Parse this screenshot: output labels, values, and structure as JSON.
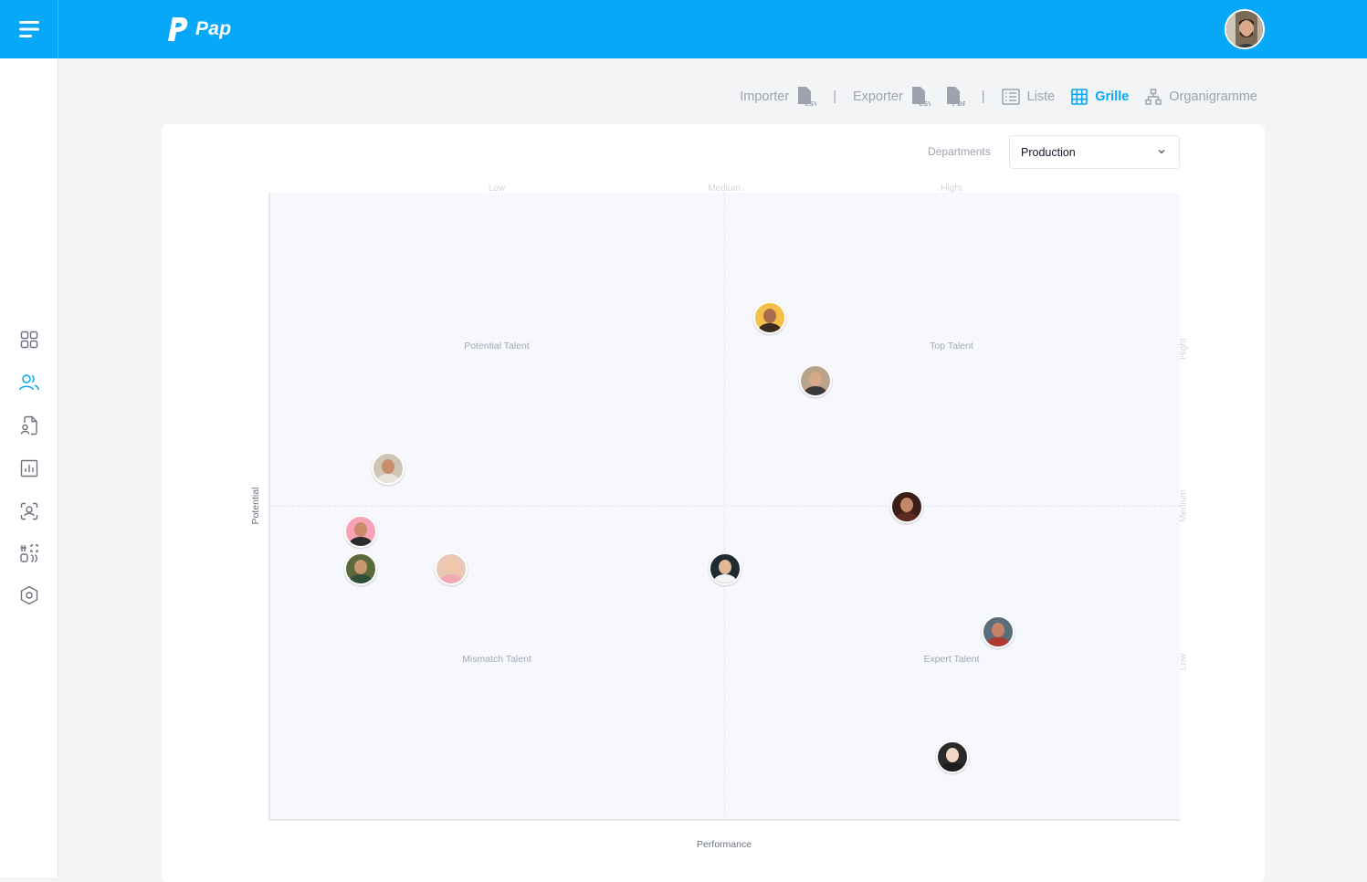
{
  "app": {
    "name": "Pap"
  },
  "toolbar": {
    "import_label": "Importer",
    "export_label": "Exporter",
    "sep": "|",
    "list_label": "Liste",
    "grid_label": "Grille",
    "orgchart_label": "Organigramme",
    "csv_badge": "CSV",
    "pdf_badge": "PDF"
  },
  "filter": {
    "label": "Departments",
    "selected": "Production"
  },
  "grid": {
    "x_axis_label": "Performance",
    "y_axis_label": "Potential",
    "col_labels": [
      "Low",
      "Medium",
      "Hight"
    ],
    "row_labels": [
      "Hight",
      "Medium",
      "Low"
    ],
    "quadrants": {
      "top_left": "Potential Talent",
      "top_right": "Top Talent",
      "bottom_left": "Mismatch Talent",
      "bottom_right": "Expert Talent"
    }
  },
  "colors": {
    "primary": "#08a8f8",
    "plot_bg": "#f7f7fe"
  },
  "chart_data": {
    "type": "scatter",
    "xlabel": "Performance",
    "ylabel": "Potential",
    "xlim": [
      0,
      1
    ],
    "ylim": [
      0,
      1
    ],
    "points": [
      {
        "x": 0.55,
        "y": 0.8,
        "bg": "#f5c04a",
        "skin": "#a76d4c",
        "shirt": "#3b2a1f"
      },
      {
        "x": 0.6,
        "y": 0.7,
        "bg": "#b8a48a",
        "skin": "#d7a986",
        "shirt": "#3a3a3a"
      },
      {
        "x": 0.13,
        "y": 0.56,
        "bg": "#cfc4b6",
        "skin": "#c68e6a",
        "shirt": "#e8e4dc"
      },
      {
        "x": 0.7,
        "y": 0.5,
        "bg": "#3a1e18",
        "skin": "#c58768",
        "shirt": "#5c2a1f"
      },
      {
        "x": 0.1,
        "y": 0.46,
        "bg": "#f7a3b7",
        "skin": "#c98a6a",
        "shirt": "#2a2a2a"
      },
      {
        "x": 0.1,
        "y": 0.4,
        "bg": "#5a6a3a",
        "skin": "#c9986f",
        "shirt": "#2f4f3a"
      },
      {
        "x": 0.2,
        "y": 0.4,
        "bg": "#e9c9b6",
        "skin": "#f0c7a8",
        "shirt": "#f1a9b8"
      },
      {
        "x": 0.5,
        "y": 0.4,
        "bg": "#1f2a33",
        "skin": "#e3b897",
        "shirt": "#f3f3f3"
      },
      {
        "x": 0.8,
        "y": 0.3,
        "bg": "#5b6d7a",
        "skin": "#c8826a",
        "shirt": "#b0382d"
      },
      {
        "x": 0.75,
        "y": 0.1,
        "bg": "#2a2a2a",
        "skin": "#f2d6c4",
        "shirt": "#1d1d1d"
      }
    ]
  }
}
